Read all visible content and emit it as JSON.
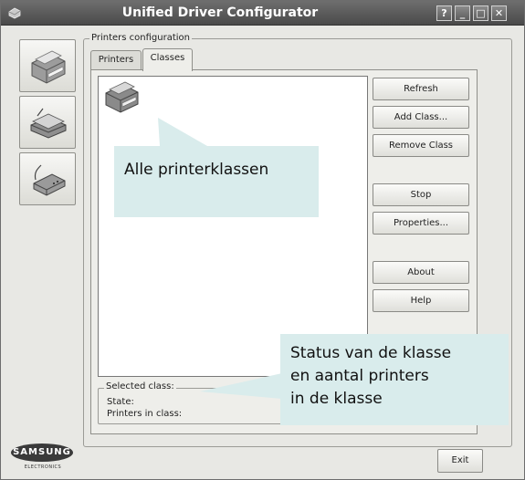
{
  "window": {
    "title": "Unified Driver Configurator",
    "controls": {
      "help": "?",
      "minimize": "_",
      "maximize": "□",
      "close": "✕"
    }
  },
  "sidebar": {
    "items": [
      {
        "name": "printers",
        "icon": "printer-icon"
      },
      {
        "name": "scanners",
        "icon": "scanner-icon"
      },
      {
        "name": "ports",
        "icon": "port-icon"
      }
    ]
  },
  "group": {
    "title": "Printers configuration",
    "tabs": [
      {
        "label": "Printers",
        "active": false
      },
      {
        "label": "Classes",
        "active": true
      }
    ]
  },
  "buttons": {
    "refresh": "Refresh",
    "add_class": "Add Class...",
    "remove_class": "Remove Class",
    "stop": "Stop",
    "properties": "Properties...",
    "about": "About",
    "help": "Help"
  },
  "selected_class": {
    "title": "Selected class:",
    "state_label": "State:",
    "printers_label": "Printers in class:"
  },
  "callouts": {
    "classes": "Alle printerklassen",
    "status": [
      "Status van de klasse",
      "en aantal printers",
      "in de klasse"
    ]
  },
  "footer": {
    "exit": "Exit",
    "logo": "SAMSUNG",
    "logo_sub": "ELECTRONICS"
  },
  "colors": {
    "titlebar": "#555555",
    "window_bg": "#e8e8e4",
    "callout_bg": "#d9ecec"
  }
}
